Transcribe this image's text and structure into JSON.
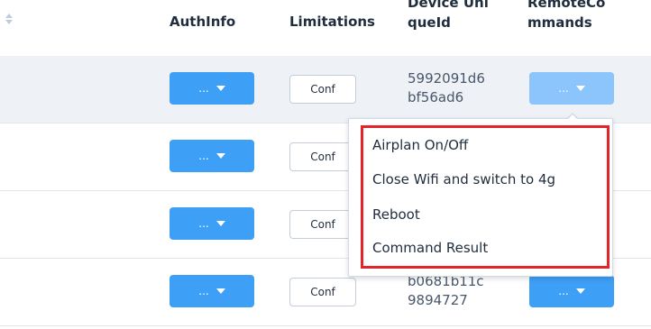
{
  "table": {
    "headers": {
      "auth_info": "AuthInfo",
      "limitations": "Limitations",
      "device_id_line1": "Device Uni",
      "device_id_line2": "queId",
      "remote_line1": "RemoteCo",
      "remote_line2": "mmands"
    },
    "rows": [
      {
        "auth_btn": "...",
        "conf_btn": "Conf",
        "device_id_line1": "5992091d6",
        "device_id_line2": "bf56ad6",
        "remote_btn": "..."
      },
      {
        "auth_btn": "...",
        "conf_btn": "Conf"
      },
      {
        "auth_btn": "...",
        "conf_btn": "Conf"
      },
      {
        "auth_btn": "...",
        "conf_btn": "Conf",
        "device_id_line1": "b0681b11c",
        "device_id_line2": "9894727",
        "remote_btn": "..."
      }
    ]
  },
  "dropdown": {
    "items": [
      "Airplan On/Off",
      "Close Wifi and switch to 4g",
      "Reboot",
      "Command Result"
    ],
    "highlight_color": "#e3242b"
  },
  "colors": {
    "primary": "#3d9ff5",
    "primary_light": "#8cc5fb",
    "hover_row": "#eef1f6"
  }
}
